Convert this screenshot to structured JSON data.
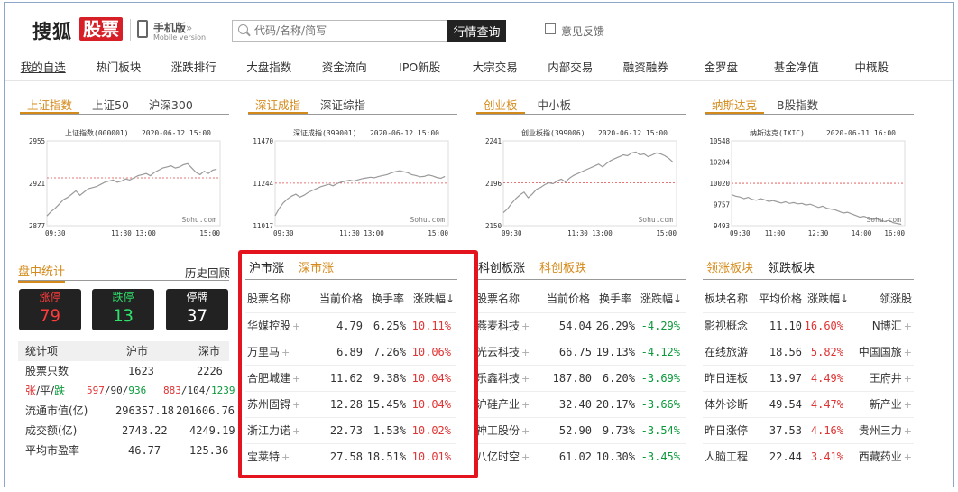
{
  "header": {
    "logo_text": "搜狐",
    "logo_box": "股票",
    "mobile_cn": "手机版",
    "mobile_arrow": "»",
    "mobile_en": "Mobile version",
    "search_placeholder": "代码/名称/简写",
    "search_button": "行情查询",
    "feedback": "意见反馈"
  },
  "nav": [
    "我的自选",
    "热门板块",
    "涨跌排行",
    "大盘指数",
    "资金流向",
    "IPO新股",
    "大宗交易",
    "内部交易",
    "融资融券",
    "金罗盘",
    "基金净值",
    "中概股"
  ],
  "indices": [
    {
      "tabs": [
        "上证指数",
        "上证50",
        "沪深300"
      ],
      "active": 0,
      "title": "上证指数(000001)",
      "date": "2020-06-12 15:00",
      "yticks": [
        "2955",
        "2921",
        "2877"
      ],
      "xticks": [
        "09:30",
        "11:30 13:00",
        "15:00"
      ],
      "watermark": "Sohu.com",
      "ylim": [
        2877,
        2955
      ],
      "prev": 2921,
      "series": [
        2886,
        2890,
        2893,
        2897,
        2901,
        2903,
        2906,
        2909,
        2905,
        2908,
        2911,
        2912,
        2913,
        2915,
        2917,
        2918,
        2919,
        2917,
        2918,
        2920,
        2919,
        2921,
        2923,
        2924,
        2925,
        2923,
        2926,
        2928,
        2930,
        2931,
        2932,
        2930,
        2931,
        2933,
        2934,
        2930,
        2926,
        2924,
        2927,
        2925,
        2928,
        2929
      ]
    },
    {
      "tabs": [
        "深证成指",
        "深证综指"
      ],
      "active": 0,
      "title": "深证成指(399001)",
      "date": "2020-06-12 15:00",
      "yticks": [
        "11470",
        "11244",
        "11017"
      ],
      "xticks": [
        "09:30",
        "11:30 13:00",
        "15:00"
      ],
      "watermark": "Sohu.com",
      "ylim": [
        11017,
        11470
      ],
      "prev": 11244,
      "series": [
        11070,
        11110,
        11140,
        11160,
        11175,
        11185,
        11170,
        11180,
        11195,
        11205,
        11215,
        11225,
        11232,
        11238,
        11230,
        11242,
        11250,
        11255,
        11260,
        11255,
        11262,
        11268,
        11272,
        11276,
        11273,
        11280,
        11285,
        11290,
        11298,
        11305,
        11310,
        11305,
        11300,
        11290,
        11285,
        11278,
        11280,
        11288,
        11283,
        11275,
        11270,
        11280
      ]
    },
    {
      "tabs": [
        "创业板",
        "中小板"
      ],
      "active": 0,
      "title": "创业板指(399006)",
      "date": "2020-06-12 15:00",
      "yticks": [
        "2241",
        "2196",
        "2150"
      ],
      "xticks": [
        "09:30",
        "11:30 13:00",
        "15:00"
      ],
      "watermark": "Sohu.com",
      "ylim": [
        2150,
        2241
      ],
      "prev": 2196,
      "series": [
        2164,
        2168,
        2174,
        2179,
        2183,
        2186,
        2180,
        2184,
        2189,
        2191,
        2194,
        2196,
        2195,
        2198,
        2200,
        2197,
        2201,
        2204,
        2206,
        2208,
        2210,
        2212,
        2214,
        2216,
        2213,
        2217,
        2220,
        2222,
        2224,
        2226,
        2225,
        2228,
        2229,
        2226,
        2227,
        2224,
        2226,
        2228,
        2227,
        2225,
        2222,
        2218
      ]
    },
    {
      "tabs": [
        "纳斯达克",
        "B股指数"
      ],
      "active": 0,
      "title": "纳斯达克(IXIC)",
      "date": "2020-06-11 16:00",
      "yticks": [
        "10548",
        "10284",
        "10020",
        "9757",
        "9493"
      ],
      "xticks": [
        "09:30",
        "11:00",
        "12:30",
        "14:00",
        "16:00"
      ],
      "watermark": "Sohu.com",
      "ylim": [
        9493,
        10548
      ],
      "prev": 10020,
      "series": [
        9880,
        9860,
        9850,
        9830,
        9845,
        9820,
        9810,
        9830,
        9815,
        9795,
        9805,
        9790,
        9775,
        9790,
        9770,
        9780,
        9765,
        9770,
        9750,
        9760,
        9740,
        9720,
        9735,
        9710,
        9700,
        9690,
        9670,
        9650,
        9660,
        9640,
        9620,
        9600,
        9610,
        9590,
        9570,
        9580,
        9560,
        9545,
        9560,
        9530,
        9520,
        9510
      ]
    }
  ],
  "stats": {
    "title": "盘中统计",
    "history": "历史回顾",
    "leds": [
      {
        "label": "涨停",
        "value": "79",
        "color": "#ff3b3b"
      },
      {
        "label": "跌停",
        "value": "13",
        "color": "#2fe06a"
      },
      {
        "label": "停牌",
        "value": "37",
        "color": "#ffffff"
      }
    ],
    "head": [
      "统计项",
      "沪市",
      "深市"
    ],
    "rows": [
      [
        "股票只数",
        "1623",
        "2226"
      ],
      [
        "流通市值(亿)",
        "296357.18",
        "201606.76"
      ],
      [
        "成交额(亿)",
        "2743.22",
        "4249.19"
      ],
      [
        "平均市盈率",
        "46.77",
        "125.36"
      ]
    ],
    "updown_label": [
      "张",
      "/平/",
      "跌"
    ],
    "updown_sh": [
      "597",
      "/90/",
      "936"
    ],
    "updown_sz": [
      "883",
      "/104/",
      "1239"
    ]
  },
  "rise_table": {
    "tabs": [
      "沪市涨",
      "深市涨"
    ],
    "head": [
      "股票名称",
      "当前价格",
      "换手率",
      "涨跌幅↓"
    ],
    "rows": [
      [
        "华媒控股",
        "4.79",
        "6.25%",
        "10.11%"
      ],
      [
        "万里马",
        "6.89",
        "7.26%",
        "10.06%"
      ],
      [
        "合肥城建",
        "11.62",
        "9.38%",
        "10.04%"
      ],
      [
        "苏州固锝",
        "12.28",
        "15.45%",
        "10.04%"
      ],
      [
        "浙江力诺",
        "22.73",
        "1.53%",
        "10.02%"
      ],
      [
        "宝莱特",
        "27.58",
        "18.51%",
        "10.01%"
      ]
    ]
  },
  "kc_table": {
    "tabs": [
      "科创板涨",
      "科创板跌"
    ],
    "head": [
      "股票名称",
      "当前价格",
      "换手率",
      "涨跌幅↓"
    ],
    "rows": [
      [
        "燕麦科技",
        "54.04",
        "26.29%",
        "-4.29%"
      ],
      [
        "光云科技",
        "66.75",
        "19.13%",
        "-4.12%"
      ],
      [
        "乐鑫科技",
        "187.80",
        "6.20%",
        "-3.69%"
      ],
      [
        "沪硅产业",
        "32.40",
        "20.17%",
        "-3.66%"
      ],
      [
        "神工股份",
        "52.90",
        "9.73%",
        "-3.54%"
      ],
      [
        "八亿时空",
        "61.02",
        "10.30%",
        "-3.45%"
      ]
    ]
  },
  "sector_table": {
    "tabs": [
      "领涨板块",
      "领跌板块"
    ],
    "head": [
      "板块名称",
      "平均价格",
      "涨跌幅↓",
      "领涨股"
    ],
    "rows": [
      [
        "影视概念",
        "11.10",
        "16.60%",
        "N博汇"
      ],
      [
        "在线旅游",
        "18.56",
        "5.82%",
        "中国国旅"
      ],
      [
        "昨日连板",
        "13.97",
        "4.49%",
        "王府井"
      ],
      [
        "体外诊断",
        "49.54",
        "4.47%",
        "新产业"
      ],
      [
        "昨日涨停",
        "37.53",
        "4.16%",
        "贵州三力"
      ],
      [
        "人脑工程",
        "22.44",
        "3.41%",
        "西藏药业"
      ]
    ]
  }
}
